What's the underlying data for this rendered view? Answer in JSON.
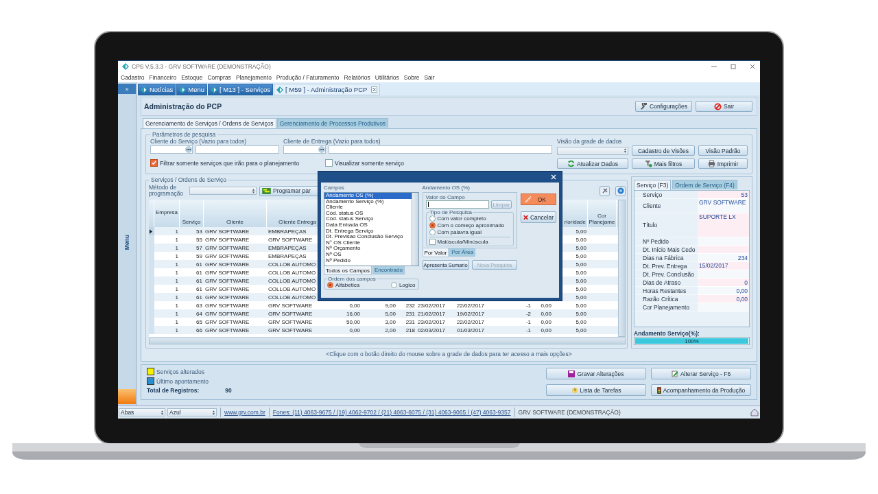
{
  "window": {
    "title": "CPS V.5.3.3 - GRV SOFTWARE (DEMONSTRAÇÃO)"
  },
  "menu": [
    "Cadastro",
    "Financeiro",
    "Estoque",
    "Compras",
    "Planejamento",
    "Produção / Faturamento",
    "Relatórios",
    "Utilitários",
    "Sobre",
    "Sair"
  ],
  "sidebar": {
    "toggle": "»",
    "label": "Menu"
  },
  "doc_tabs": [
    {
      "label": "Notícias",
      "selected": false
    },
    {
      "label": "Menu",
      "selected": false
    },
    {
      "label": "[ M13 ] - Serviços",
      "selected": false
    },
    {
      "label": "[ M59 ] - Administração PCP",
      "selected": true
    }
  ],
  "page": {
    "title": "Administração do PCP",
    "buttons": [
      {
        "label": "Configurações",
        "kind": "settings"
      },
      {
        "label": "Sair",
        "kind": "exit"
      }
    ]
  },
  "section_tabs": [
    {
      "label": "Gerenciamento de Serviços / Ordens de Serviços",
      "selected": true
    },
    {
      "label": "Gerenciamento de Processos Produtivos",
      "selected": false
    }
  ],
  "search": {
    "legend": "Parâmetros de pesquisa",
    "service_client_label": "Cliente do Serviço (Vazio para todos)",
    "delivery_client_label": "Cliente de Entrega (Vazio para todos)",
    "grid_view_label": "Visão da grade de dados",
    "options": [
      {
        "label": "Filtrar somente serviços que irão para o planejamento",
        "checked": true
      },
      {
        "label": "Visualizar somente serviço",
        "checked": false
      }
    ],
    "buttons": [
      {
        "label": "Cadastro de Visões",
        "kind": "plain"
      },
      {
        "label": "Visão Padrão",
        "kind": "plain"
      },
      {
        "label": "Atualizar Dados",
        "kind": "refresh"
      },
      {
        "label": "Mais filtros",
        "kind": "filter"
      },
      {
        "label": "Imprimir",
        "kind": "print"
      }
    ]
  },
  "services": {
    "legend": "Serviços / Ordens de Serviço",
    "method_label": "Método de programação",
    "program_button": "Programar par",
    "columns": [
      "Empresa",
      "Serviço",
      "Cliente",
      "Cliente Entrega",
      "rioridade",
      "Cor Planejame"
    ],
    "rows": [
      {
        "kind": "covered",
        "current": true,
        "cells": [
          "1",
          "53",
          "GRV SOFTWARE",
          "EMBRAPEÇAS",
          "5,00"
        ]
      },
      {
        "kind": "covered",
        "current": false,
        "cells": [
          "1",
          "55",
          "GRV SOFTWARE",
          "GRV SOFTWARE",
          "5,00"
        ]
      },
      {
        "kind": "covered",
        "current": false,
        "cells": [
          "1",
          "57",
          "GRV SOFTWARE",
          "EMBRAPEÇAS",
          "5,00"
        ]
      },
      {
        "kind": "covered",
        "current": false,
        "cells": [
          "1",
          "59",
          "GRV SOFTWARE",
          "EMBRAPEÇAS",
          "5,00"
        ]
      },
      {
        "kind": "covered",
        "current": false,
        "cells": [
          "1",
          "61",
          "GRV SOFTWARE",
          "COLLOB AUTOMO",
          "5,00"
        ]
      },
      {
        "kind": "covered",
        "current": false,
        "cells": [
          "1",
          "61",
          "GRV SOFTWARE",
          "COLLOB AUTOMO",
          "5,00"
        ]
      },
      {
        "kind": "covered",
        "current": false,
        "cells": [
          "1",
          "61",
          "GRV SOFTWARE",
          "COLLOB AUTOMO",
          "5,00"
        ]
      },
      {
        "kind": "covered",
        "current": false,
        "cells": [
          "1",
          "61",
          "GRV SOFTWARE",
          "COLLOB AUTOMO",
          "5,00"
        ]
      },
      {
        "kind": "covered",
        "current": false,
        "cells": [
          "1",
          "61",
          "GRV SOFTWARE",
          "COLLOB AUTOMO",
          "5,00"
        ]
      },
      {
        "kind": "full",
        "current": false,
        "cells": [
          "1",
          "63",
          "GRV SOFTWARE",
          "GRV SOFTWARE",
          "0,00",
          "9,00",
          "232",
          "23/02/2017",
          "22/02/2017",
          "-1",
          "0,00",
          "5,00"
        ]
      },
      {
        "kind": "full",
        "current": false,
        "cells": [
          "1",
          "64",
          "GRV SOFTWARE",
          "GRV SOFTWARE",
          "16,00",
          "5,00",
          "231",
          "21/02/2017",
          "19/02/2017",
          "-2",
          "0,00",
          "5,00"
        ]
      },
      {
        "kind": "full",
        "current": false,
        "cells": [
          "1",
          "65",
          "GRV SOFTWARE",
          "GRV SOFTWARE",
          "50,00",
          "3,00",
          "231",
          "23/02/2017",
          "22/02/2017",
          "-1",
          "0,00",
          "5,00"
        ]
      },
      {
        "kind": "full",
        "current": false,
        "cells": [
          "1",
          "66",
          "GRV SOFTWARE",
          "GRV SOFTWARE",
          "0,00",
          "2,00",
          "218",
          "02/03/2017",
          "01/03/2017",
          "-1",
          "0,00",
          "5,00"
        ]
      }
    ],
    "hint": "<Clique com o botão direito do mouse sobre a grade de dados para ter acesso a mais opções>"
  },
  "details": {
    "tabs": [
      {
        "label": "Serviço (F3)",
        "selected": true
      },
      {
        "label": "Ordem de Serviço (F4)",
        "selected": false
      }
    ],
    "fields": [
      {
        "label": "Serviço",
        "value": "53",
        "kind": "number"
      },
      {
        "label": "Cliente",
        "value": "GRV SOFTWARE",
        "kind": "text"
      },
      {
        "label": "Título",
        "value": "SUPORTE LX",
        "kind": "memo"
      },
      {
        "label": "Nº Pedido"
      },
      {
        "label": "Dt. Início Mais Cedo"
      },
      {
        "label": "Dias na Fábrica",
        "value": "234",
        "kind": "number"
      },
      {
        "label": "Dt. Prev. Entrega",
        "value": "15/02/2017",
        "kind": "date"
      },
      {
        "label": "Dt. Prev. Conclusão"
      },
      {
        "label": "Dias de Atraso",
        "value": "0",
        "kind": "number"
      },
      {
        "label": "Horas Restantes",
        "value": "0,00",
        "kind": "number"
      },
      {
        "label": "Razão Crítica",
        "value": "0,00",
        "kind": "number"
      },
      {
        "label": "Cor Planejamento"
      }
    ],
    "progress": {
      "label": "Andamento Serviço(%):",
      "level": 1,
      "reading": "100%"
    }
  },
  "footer": {
    "legend": [
      {
        "label": "Serviços alterados",
        "color": "#f5f000"
      },
      {
        "label": "Último apontamento",
        "color": "#2a8fd0"
      }
    ],
    "total_label": "Total de Registros:",
    "total": "90",
    "buttons": [
      {
        "label": "Gravar Alterações",
        "kind": "save"
      },
      {
        "label": "Alterar Serviço - F6",
        "kind": "edit"
      },
      {
        "label": "Lista de Tarefas",
        "kind": "tasks"
      },
      {
        "label": "Acompanhamento da Produção",
        "kind": "traffic"
      }
    ]
  },
  "status_bar": {
    "tabs_select": "Abas",
    "theme_select": "Azul",
    "link": "www.grv.com.br",
    "phones": "Fones: (11) 4063-9675 / (19) 4062-9702 / (21) 4063-6075 / (31) 4063-9065 / (47) 4063-9357",
    "company": "GRV SOFTWARE (DEMONSTRAÇÃO)"
  },
  "dialog": {
    "fields_label": "Campos",
    "fields": [
      {
        "label": "Andamento OS (%)",
        "selected": true
      },
      {
        "label": "Andamento Serviço (%)",
        "selected": false
      },
      {
        "label": "Cliente",
        "selected": false
      },
      {
        "label": "Cód. status OS",
        "selected": false
      },
      {
        "label": "Cód. status Serviço",
        "selected": false
      },
      {
        "label": "Data Entrada OS",
        "selected": false
      },
      {
        "label": "Dt. Entrega Serviço",
        "selected": false
      },
      {
        "label": "Dt. Previsao Conclusão Serviço",
        "selected": false
      },
      {
        "label": "N° OS Cliente",
        "selected": false
      },
      {
        "label": "Nº Orçamento",
        "selected": false
      },
      {
        "label": "Nº OS",
        "selected": false
      },
      {
        "label": "Nº Pedido",
        "selected": false
      }
    ],
    "list_tabs": [
      {
        "label": "Todos os Campos",
        "selected": true
      },
      {
        "label": "Encontrado",
        "selected": false
      }
    ],
    "order_legend": "Ordem dos campos",
    "order_options": [
      {
        "label": "Alfabetica",
        "selected": true
      },
      {
        "label": "Logico",
        "selected": false
      }
    ],
    "field_title": "Andamento OS (%)",
    "value_label": "Valor do Campo",
    "clear_button": {
      "label": "Limpar",
      "disabled": true
    },
    "search_type_legend": "Tipo de Pesquisa",
    "search_types": [
      {
        "label": "Com valor completo",
        "selected": false
      },
      {
        "label": "Com o começo aproximado",
        "selected": true
      },
      {
        "label": "Com palavra igual",
        "selected": false
      }
    ],
    "case_option": {
      "label": "Maiúscula/Minúscula",
      "checked": false
    },
    "mode_tabs": [
      {
        "label": "Por Valor",
        "selected": true
      },
      {
        "label": "Por Área",
        "selected": false
      }
    ],
    "summary_button": {
      "label": "Apresenta Sumario",
      "disabled": false
    },
    "new_search_button": {
      "label": "Nova Pesquisa",
      "disabled": true
    },
    "ok_button": "OK",
    "cancel_button": "Cancelar"
  }
}
